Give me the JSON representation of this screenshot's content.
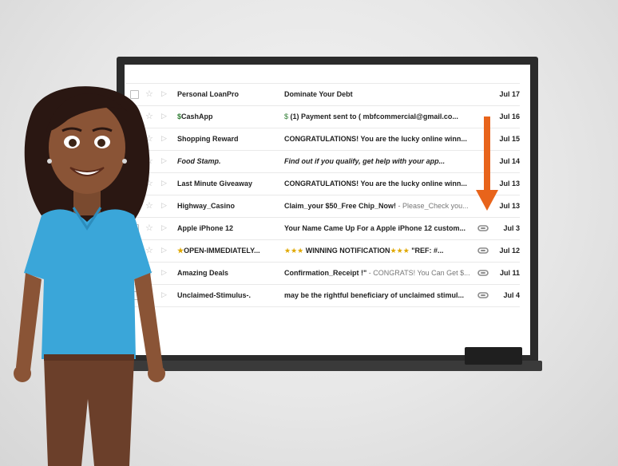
{
  "emails": [
    {
      "sender": "Personal LoanPro",
      "sender_icon": "",
      "subject": "Dominate Your Debt",
      "snippet": "",
      "attachment": false,
      "date": "Jul 17",
      "italic": false
    },
    {
      "sender": "CashApp",
      "sender_icon": "dollar-icon",
      "subject": "(1) Payment sent to ( mbfcommercial@gmail.co...",
      "subject_icon": "dollar-icon",
      "snippet": "",
      "attachment": false,
      "date": "Jul 16",
      "italic": false
    },
    {
      "sender": "Shopping Reward",
      "sender_icon": "",
      "subject": "CONGRATULATIONS! You are the lucky online winn...",
      "snippet": "",
      "attachment": false,
      "date": "Jul 15",
      "italic": false
    },
    {
      "sender": "Food Stamp.",
      "sender_icon": "",
      "subject": "Find out if you qualify, get help with your app...",
      "snippet": "",
      "attachment": false,
      "date": "Jul 14",
      "italic": true
    },
    {
      "sender": "Last Minute Giveaway",
      "sender_icon": "",
      "subject": "CONGRATULATIONS! You are the lucky online winn...",
      "snippet": "",
      "attachment": false,
      "date": "Jul 13",
      "italic": false
    },
    {
      "sender": "Highway_Casino",
      "sender_icon": "",
      "subject": "Claim_your $50_Free Chip_Now!",
      "snippet": " - Please_Check you...",
      "attachment": false,
      "date": "Jul 13",
      "italic": false
    },
    {
      "sender": "Apple iPhone 12",
      "sender_icon": "",
      "subject": "Your Name Came Up For a Apple iPhone 12 custom...",
      "snippet": "",
      "attachment": true,
      "date": "Jul 3",
      "italic": false
    },
    {
      "sender": "OPEN-IMMEDIATELY...",
      "sender_icon": "star-icon",
      "subject": "WINNING NOTIFICATION",
      "subject_prefix": "★★★",
      "subject_suffix": "★★★",
      "snippet": " \"REF: #...",
      "attachment": true,
      "date": "Jul 12",
      "italic": false
    },
    {
      "sender": "Amazing Deals",
      "sender_icon": "",
      "subject": "Confirmation_Receipt !\"",
      "snippet": " - CONGRATS! You Can Get $...",
      "attachment": true,
      "date": "Jul 11",
      "italic": false
    },
    {
      "sender": "Unclaimed-Stimulus-.",
      "sender_icon": "",
      "subject": "may be the rightful beneficiary of unclaimed stimul...",
      "snippet": "",
      "attachment": true,
      "date": "Jul 4",
      "italic": false
    }
  ],
  "colors": {
    "arrow": "#e8641b",
    "shirt": "#3aa6d9",
    "hair": "#2a1712",
    "skin": "#8a5436",
    "pants": "#6b3f2a",
    "board_frame": "#2b2b2b"
  }
}
